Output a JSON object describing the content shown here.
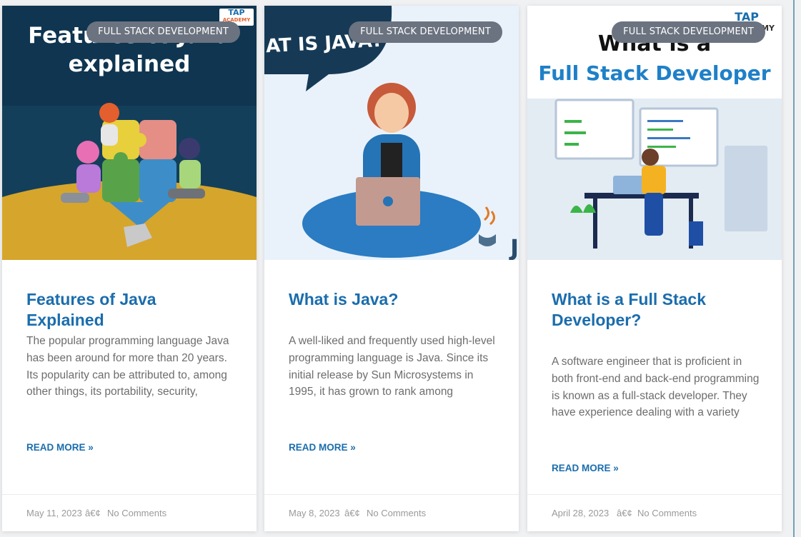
{
  "colors": {
    "accent": "#1a6dad",
    "badge_bg": "#6b7380",
    "text_muted": "#6d6d6d",
    "meta": "#9a9a9a"
  },
  "posts": [
    {
      "category": "FULL STACK DEVELOPMENT",
      "image_text": [
        "Features of Java",
        "explained"
      ],
      "brand": [
        "TAP",
        "ACADEMY"
      ],
      "title": "Features of Java Explained",
      "excerpt": "The popular programming language Java has been around for more than 20 years. Its popularity can be attributed to, among other things, its portability, security,",
      "read_more": "READ MORE »",
      "date": "May 11, 2023",
      "separator": "â€¢",
      "comments": "No Comments"
    },
    {
      "category": "FULL STACK DEVELOPMENT",
      "image_text": [
        "AT IS JAVA?"
      ],
      "brand_logo_text": "J",
      "title": "What is Java?",
      "excerpt": "A well-liked and frequently used high-level programming language is Java. Since its initial release by Sun Microsystems in 1995, it has grown to rank among",
      "read_more": "READ MORE »",
      "date": "May 8, 2023",
      "separator": "â€¢",
      "comments": "No Comments"
    },
    {
      "category": "FULL STACK DEVELOPMENT",
      "image_text": [
        "What is a",
        "Full Stack Developer"
      ],
      "brand": [
        "TAP",
        "ACADEMY"
      ],
      "title": "What is a Full Stack Developer?",
      "excerpt": "A software engineer that is proficient in both front-end and back-end programming is known as a full-stack developer. They have experience dealing with a variety",
      "read_more": "READ MORE »",
      "date": "April 28, 2023",
      "separator": "â€¢",
      "comments": "No Comments"
    }
  ]
}
